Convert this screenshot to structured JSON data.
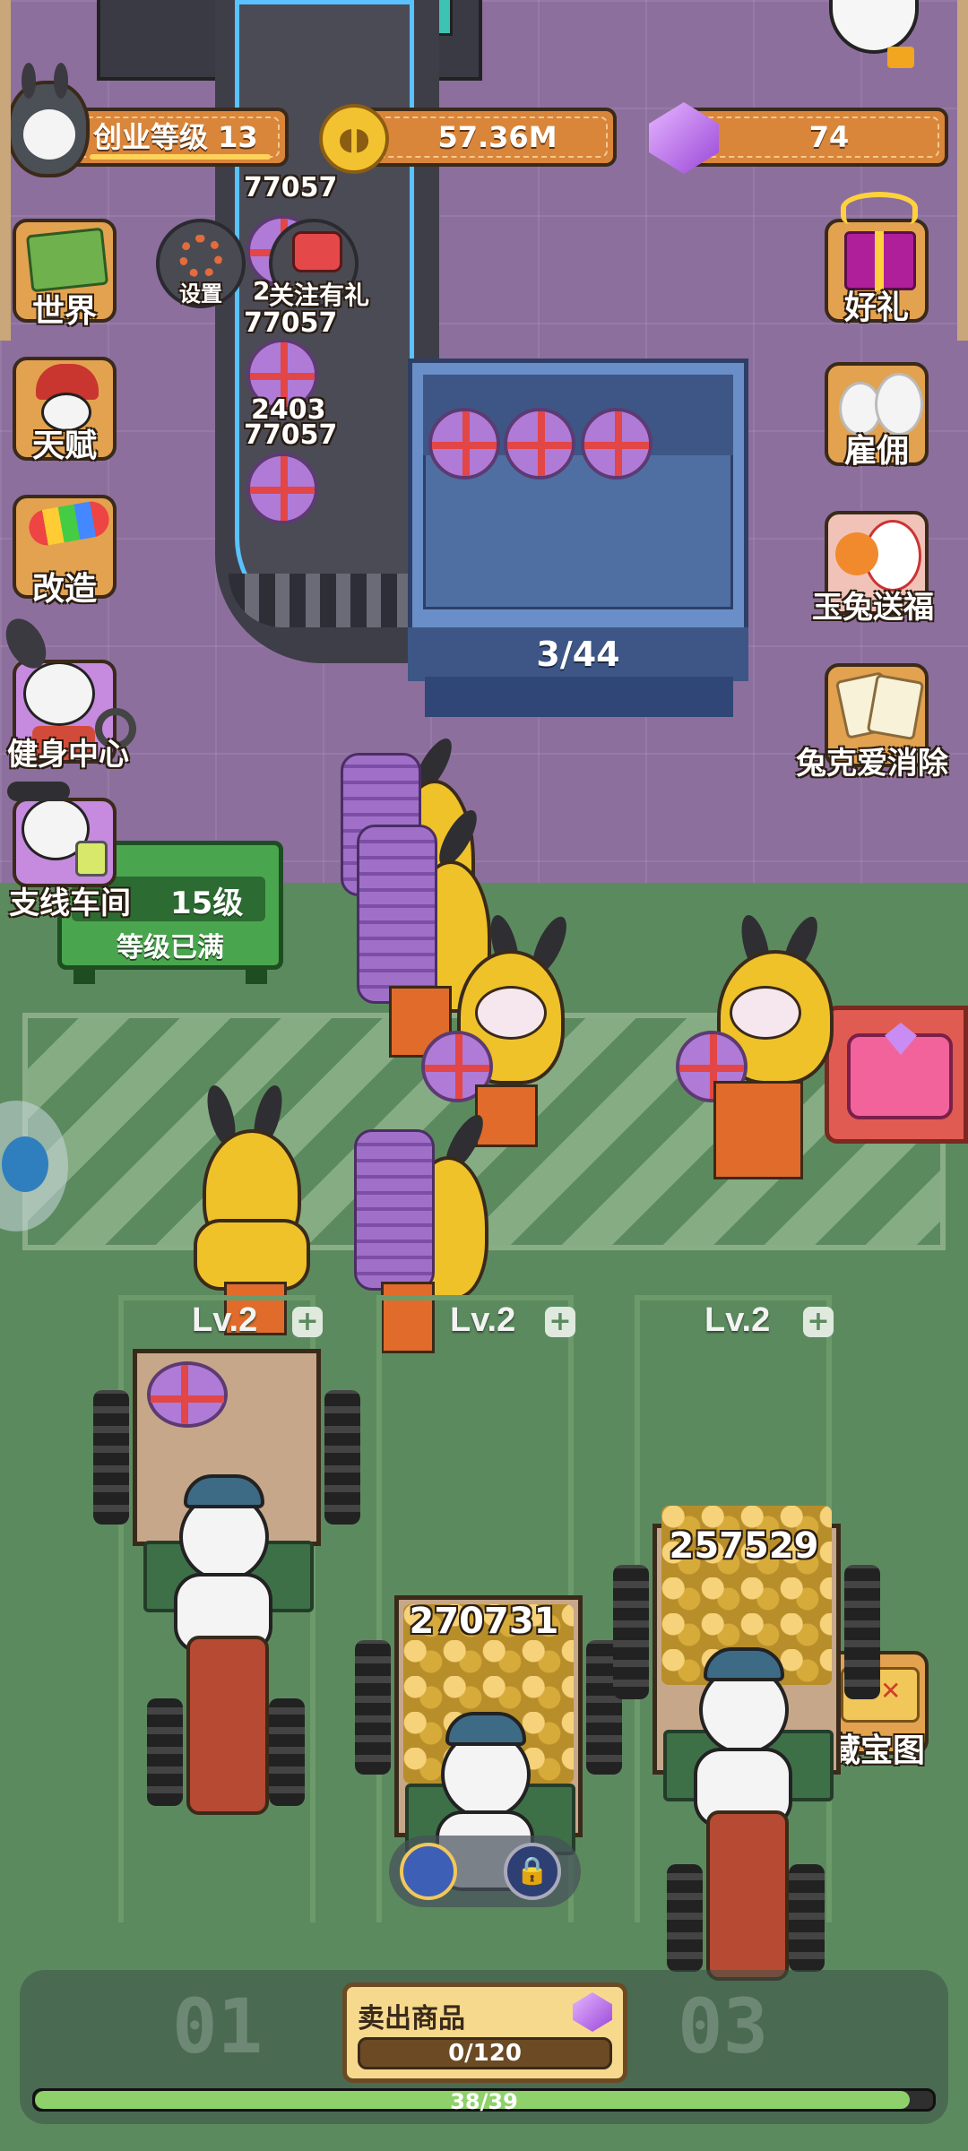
{
  "header": {
    "level_label": "创业等级 13",
    "currency": "57.36M",
    "gems": "74"
  },
  "left_menu": {
    "world": "世界",
    "talent": "天赋",
    "remodel": "改造",
    "gym": "健身中心",
    "branch_workshop": "支线车间",
    "settings": "设置",
    "follow_gift": "关注有礼",
    "follow_gift_count": "2"
  },
  "right_menu": {
    "gift": "好礼",
    "hire": "雇佣",
    "jade_rabbit": "玉兔送福",
    "elimination": "兔克爱消除",
    "treasure_map": "藏宝图"
  },
  "conveyor": {
    "labels": [
      "77057",
      "77057",
      "2403",
      "77057"
    ]
  },
  "storage": {
    "count": "3/44"
  },
  "workshop_sign": {
    "level": "15级",
    "status": "等级已满"
  },
  "lanes": [
    {
      "label": "Lv.2"
    },
    {
      "label": "Lv.2"
    },
    {
      "label": "Lv.2"
    }
  ],
  "trucks": {
    "truck2_coins": "270731",
    "truck3_coins": "257529"
  },
  "bottom": {
    "dock1": "01",
    "dock3": "03",
    "sell_label": "卖出商品",
    "sell_progress": "0/120",
    "sell_progress_value": 0,
    "main_progress": "38/39",
    "main_progress_value": 0.974
  },
  "colors": {
    "floor": "#8d6f9e",
    "yard": "#5c8a5f",
    "accent_orange": "#d9853a",
    "belt_glow": "#59c2ff",
    "progress_green": "#8ed16a"
  }
}
